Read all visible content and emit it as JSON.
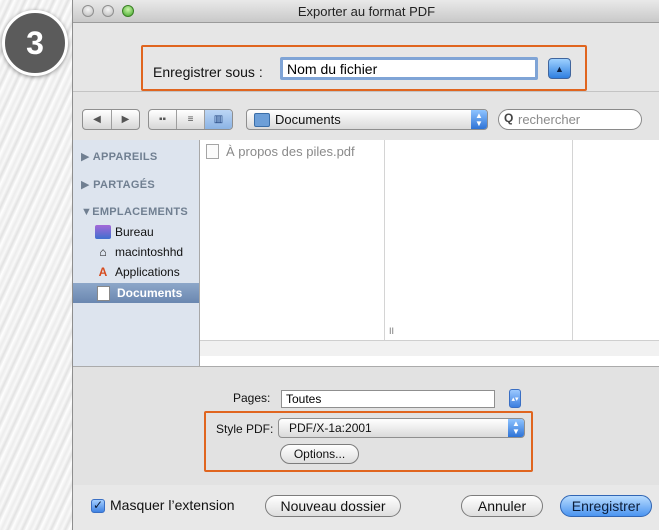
{
  "step": {
    "number": "3"
  },
  "window": {
    "title": "Exporter au format PDF"
  },
  "save": {
    "label": "Enregistrer sous :",
    "filename": "Nom du fichier"
  },
  "toolbar": {
    "location": "Documents",
    "search_placeholder": "rechercher"
  },
  "sidebar": {
    "devices": "APPAREILS",
    "shared": "PARTAGÉS",
    "places": "EMPLACEMENTS",
    "items": [
      {
        "label": "Bureau",
        "icon": "desktop-icon"
      },
      {
        "label": "macintoshhd",
        "icon": "home-icon"
      },
      {
        "label": "Applications",
        "icon": "applications-icon"
      },
      {
        "label": "Documents",
        "icon": "document-icon"
      }
    ]
  },
  "browser": {
    "files": [
      "À propos des piles.pdf"
    ]
  },
  "options": {
    "pages_label": "Pages:",
    "pages_value": "Toutes",
    "pdf_style_label": "Style PDF:",
    "pdf_style_value": "PDF/X-1a:2001",
    "options_button": "Options..."
  },
  "footer": {
    "hide_extension": "Masquer l’extension",
    "hide_extension_checked": true,
    "new_folder": "Nouveau dossier",
    "cancel": "Annuler",
    "save": "Enregistrer"
  },
  "colors": {
    "highlight": "#e0651f",
    "accent": "#3c7fe0"
  }
}
